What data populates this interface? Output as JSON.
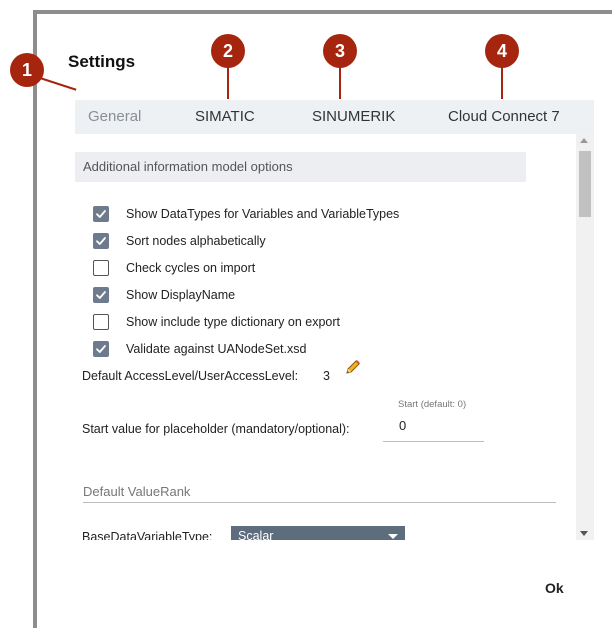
{
  "dialog": {
    "title": "Settings"
  },
  "tabs": [
    {
      "label": "General",
      "active": true
    },
    {
      "label": "SIMATIC",
      "active": false
    },
    {
      "label": "SINUMERIK",
      "active": false
    },
    {
      "label": "Cloud Connect 7",
      "active": false
    }
  ],
  "general": {
    "section_title": "Additional information model options",
    "checkboxes": [
      {
        "label": "Show DataTypes for Variables and VariableTypes",
        "checked": true
      },
      {
        "label": "Sort nodes alphabetically",
        "checked": true
      },
      {
        "label": "Check cycles on import",
        "checked": false
      },
      {
        "label": "Show DisplayName",
        "checked": true
      },
      {
        "label": "Show include type dictionary on export",
        "checked": false
      },
      {
        "label": "Validate against UANodeSet.xsd",
        "checked": true
      }
    ],
    "access_level": {
      "label": "Default AccessLevel/UserAccessLevel:",
      "value": "3",
      "edit_icon": "pencil-icon"
    },
    "placeholder_start": {
      "label": "Start value for placeholder (mandatory/optional):",
      "field_caption": "Start (default: 0)",
      "value": "0"
    },
    "value_rank": {
      "placeholder": "Default ValueRank"
    },
    "base_data_variable_type": {
      "label": "BaseDataVariableType:",
      "selected": "Scalar"
    }
  },
  "footer": {
    "ok_label": "Ok"
  },
  "callouts": [
    "1",
    "2",
    "3",
    "4"
  ],
  "colors": {
    "callout": "#a6250e",
    "accent": "#6d7b8c",
    "select_bg": "#5d6d7e"
  }
}
